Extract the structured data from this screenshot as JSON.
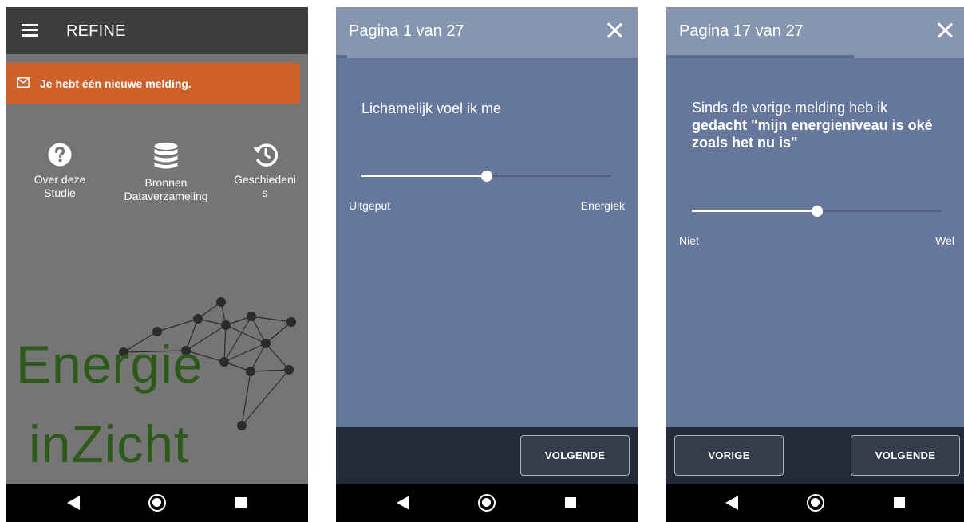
{
  "screen1": {
    "app_title": "REFINE",
    "notification": "Je hebt één nieuwe melding.",
    "menu": [
      {
        "label": "Over deze\nStudie",
        "icon": "help-circle-icon"
      },
      {
        "label": "Bronnen\nDataverzameling",
        "icon": "database-icon"
      },
      {
        "label": "Geschiedeni\ns",
        "icon": "history-icon"
      }
    ],
    "logo": {
      "line1": "Energie",
      "line2": "inZicht"
    },
    "colors": {
      "appbar": "#3d3d3d",
      "background": "#757575",
      "notification": "#d1612b",
      "logo_text": "#2d5a1a"
    }
  },
  "screen2": {
    "title": "Pagina 1 van 27",
    "progress": 0.037,
    "question": "Lichamelijk voel ik me",
    "slider": {
      "value": 0.5,
      "min_label": "Uitgeput",
      "max_label": "Energiek"
    },
    "next_button": "VOLGENDE"
  },
  "screen3": {
    "title": "Pagina 17 van 27",
    "progress": 0.63,
    "question_intro": "Sinds de vorige melding heb ik",
    "question_bold": "gedacht \"mijn energieniveau is oké zoals het nu is\"",
    "slider": {
      "value": 0.5,
      "min_label": "Niet",
      "max_label": "Wel"
    },
    "prev_button": "VORIGE",
    "next_button": "VOLGENDE"
  },
  "colors": {
    "question_bg": "#65779a",
    "header_bg": "#8796af",
    "footer_bg": "#232a39",
    "navbar": "#000000"
  }
}
